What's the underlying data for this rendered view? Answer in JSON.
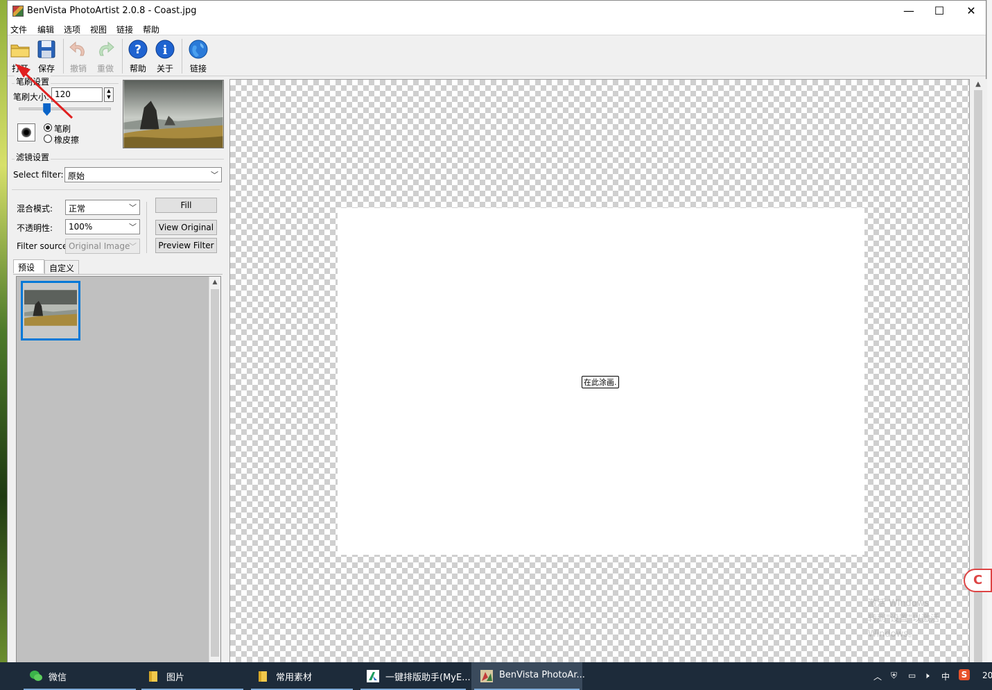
{
  "window": {
    "title": "BenVista PhotoArtist 2.0.8 - Coast.jpg",
    "controls": {
      "minimize": "—",
      "maximize": "☐",
      "close": "✕"
    }
  },
  "menu": [
    "文件",
    "编辑",
    "选项",
    "视图",
    "链接",
    "帮助"
  ],
  "toolbar": {
    "open": "打开",
    "save": "保存",
    "undo": "撤销",
    "redo": "重做",
    "help": "帮助",
    "about": "关于",
    "link": "链接"
  },
  "brush_settings": {
    "group": "笔刷设置",
    "size_label": "笔刷大小:",
    "size_value": "120",
    "size_level": 0.31,
    "mode_brush": "笔刷",
    "mode_eraser": "橡皮擦",
    "mode_selected": "brush"
  },
  "filter_settings": {
    "group": "滤镜设置",
    "select_filter_label": "Select filter:",
    "select_filter_value": "原始",
    "blend_label": "混合模式:",
    "blend_value": "正常",
    "opacity_label": "不透明性:",
    "opacity_value": "100%",
    "source_label": "Filter source:",
    "source_value": "Original Image",
    "fill_button": "Fill",
    "view_original_button": "View Original",
    "preview_filter_button": "Preview Filter"
  },
  "tabs": [
    "预设",
    "自定义"
  ],
  "canvas": {
    "hint": "在此涂画.",
    "watermark_line1": "激活 Windows",
    "watermark_line2": "转到\"设置\"以激活 Windows。"
  },
  "taskbar": {
    "items": [
      "微信",
      "图片",
      "常用素材",
      "一键排版助手(MyE...",
      "BenVista PhotoAr..."
    ],
    "ime": "中",
    "clock": "20"
  },
  "colors": {
    "selection_blue": "#0078d7",
    "annotation_red": "#e02020",
    "taskbar": "#1d2b3a"
  }
}
